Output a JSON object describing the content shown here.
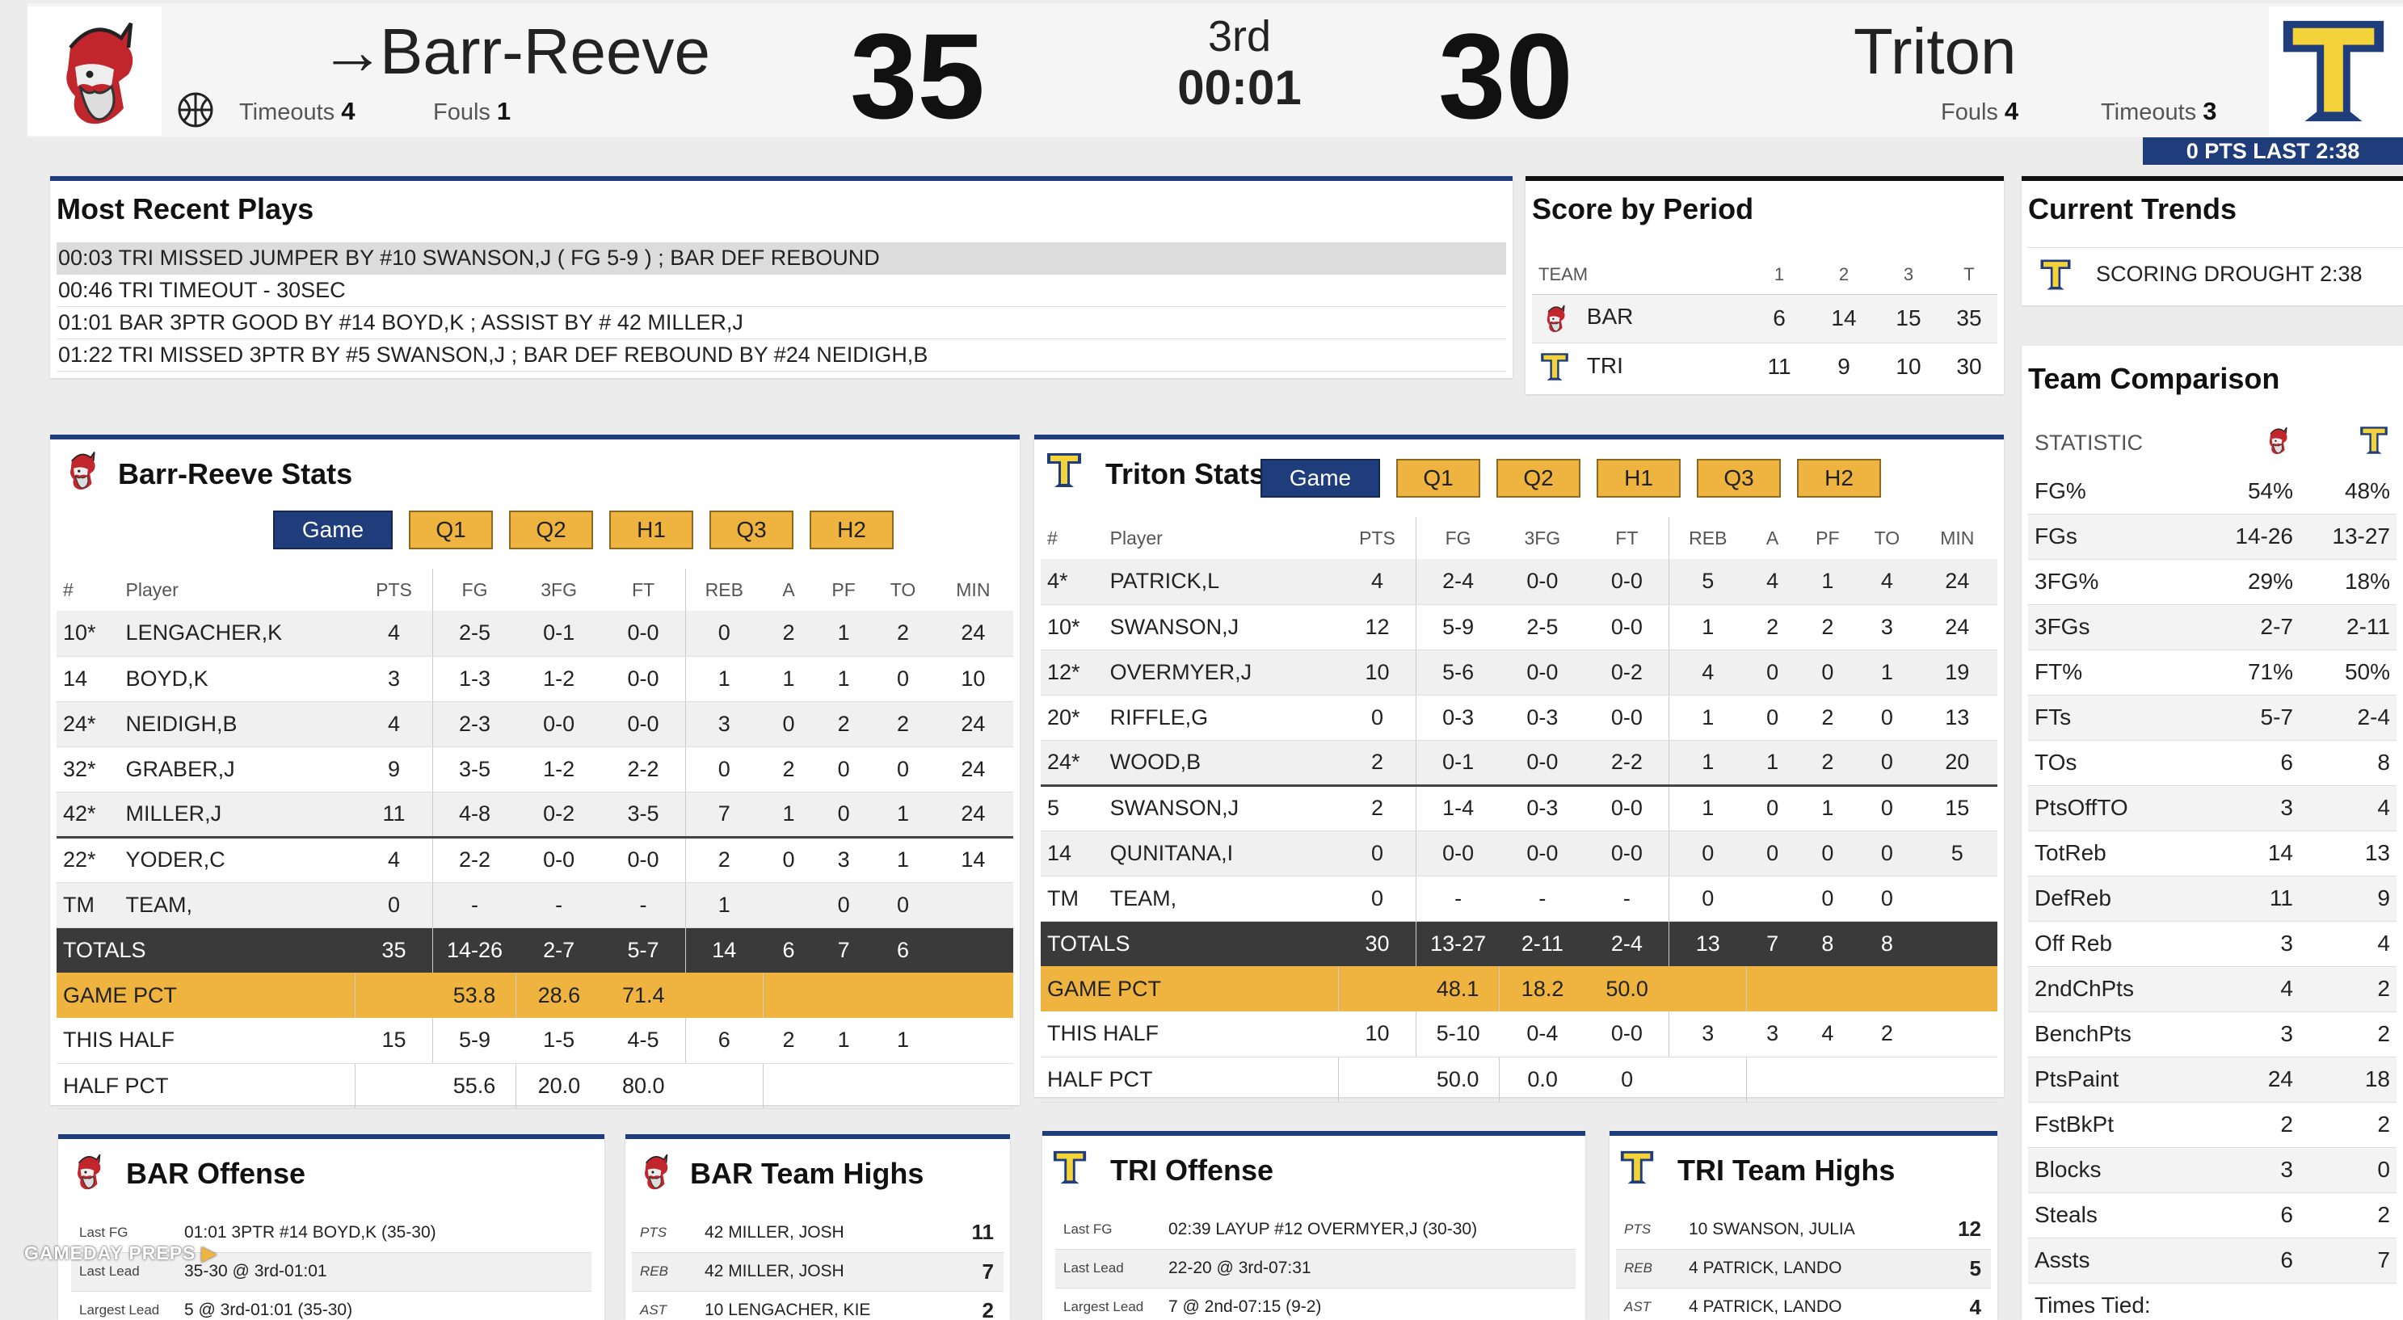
{
  "scoreboard": {
    "home": {
      "name": "Barr-Reeve",
      "score": "35",
      "timeouts_label": "Timeouts",
      "timeouts": "4",
      "fouls_label": "Fouls",
      "fouls": "1",
      "possession_arrow": "→"
    },
    "away": {
      "name": "Triton",
      "score": "30",
      "fouls_label": "Fouls",
      "fouls": "4",
      "timeouts_label": "Timeouts",
      "timeouts": "3"
    },
    "period": "3rd",
    "clock": "00:01",
    "drought_bar": "0 PTS LAST 2:38"
  },
  "recent_plays": {
    "title": "Most Recent Plays",
    "items": [
      "00:03 TRI MISSED JUMPER BY #10 SWANSON,J ( FG 5-9 ) ; BAR DEF REBOUND",
      "00:46 TRI TIMEOUT - 30SEC",
      "01:01 BAR 3PTR GOOD BY #14 BOYD,K ; ASSIST BY # 42 MILLER,J",
      "01:22 TRI MISSED 3PTR BY #5 SWANSON,J ; BAR DEF REBOUND BY #24 NEIDIGH,B"
    ]
  },
  "score_by_period": {
    "title": "Score by Period",
    "headers": [
      "TEAM",
      "1",
      "2",
      "3",
      "T"
    ],
    "rows": [
      {
        "team": "BAR",
        "p1": "6",
        "p2": "14",
        "p3": "15",
        "t": "35"
      },
      {
        "team": "TRI",
        "p1": "11",
        "p2": "9",
        "p3": "10",
        "t": "30"
      }
    ]
  },
  "trends": {
    "title": "Current Trends",
    "item": "SCORING DROUGHT 2:38"
  },
  "buttons": [
    "Game",
    "Q1",
    "Q2",
    "H1",
    "Q3",
    "H2"
  ],
  "stat_headers": [
    "#",
    "Player",
    "PTS",
    "FG",
    "3FG",
    "FT",
    "REB",
    "A",
    "PF",
    "TO",
    "MIN"
  ],
  "home_stats": {
    "title": "Barr-Reeve Stats",
    "players": [
      [
        "10*",
        "LENGACHER,K",
        "4",
        "2-5",
        "0-1",
        "0-0",
        "0",
        "2",
        "1",
        "2",
        "24"
      ],
      [
        "14",
        "BOYD,K",
        "3",
        "1-3",
        "1-2",
        "0-0",
        "1",
        "1",
        "1",
        "0",
        "10"
      ],
      [
        "24*",
        "NEIDIGH,B",
        "4",
        "2-3",
        "0-0",
        "0-0",
        "3",
        "0",
        "2",
        "2",
        "24"
      ],
      [
        "32*",
        "GRABER,J",
        "9",
        "3-5",
        "1-2",
        "2-2",
        "0",
        "2",
        "0",
        "0",
        "24"
      ],
      [
        "42*",
        "MILLER,J",
        "11",
        "4-8",
        "0-2",
        "3-5",
        "7",
        "1",
        "0",
        "1",
        "24"
      ],
      [
        "22*",
        "YODER,C",
        "4",
        "2-2",
        "0-0",
        "0-0",
        "2",
        "0",
        "3",
        "1",
        "14"
      ],
      [
        "TM",
        "TEAM,",
        "0",
        "-",
        "-",
        "-",
        "1",
        "",
        "0",
        "0",
        ""
      ]
    ],
    "totals": [
      "TOTALS",
      "35",
      "14-26",
      "2-7",
      "5-7",
      "14",
      "6",
      "7",
      "6"
    ],
    "game_pct": [
      "GAME PCT",
      "53.8",
      "28.6",
      "71.4"
    ],
    "this_half": [
      "THIS HALF",
      "15",
      "5-9",
      "1-5",
      "4-5",
      "6",
      "2",
      "1",
      "1"
    ],
    "half_pct": [
      "HALF PCT",
      "55.6",
      "20.0",
      "80.0"
    ]
  },
  "away_stats": {
    "title": "Triton Stats",
    "players": [
      [
        "4*",
        "PATRICK,L",
        "4",
        "2-4",
        "0-0",
        "0-0",
        "5",
        "4",
        "1",
        "4",
        "24"
      ],
      [
        "10*",
        "SWANSON,J",
        "12",
        "5-9",
        "2-5",
        "0-0",
        "1",
        "2",
        "2",
        "3",
        "24"
      ],
      [
        "12*",
        "OVERMYER,J",
        "10",
        "5-6",
        "0-0",
        "0-2",
        "4",
        "0",
        "0",
        "1",
        "19"
      ],
      [
        "20*",
        "RIFFLE,G",
        "0",
        "0-3",
        "0-3",
        "0-0",
        "1",
        "0",
        "2",
        "0",
        "13"
      ],
      [
        "24*",
        "WOOD,B",
        "2",
        "0-1",
        "0-0",
        "2-2",
        "1",
        "1",
        "2",
        "0",
        "20"
      ],
      [
        "5",
        "SWANSON,J",
        "2",
        "1-4",
        "0-3",
        "0-0",
        "1",
        "0",
        "1",
        "0",
        "15"
      ],
      [
        "14",
        "QUNITANA,I",
        "0",
        "0-0",
        "0-0",
        "0-0",
        "0",
        "0",
        "0",
        "0",
        "5"
      ],
      [
        "TM",
        "TEAM,",
        "0",
        "-",
        "-",
        "-",
        "0",
        "",
        "0",
        "0",
        ""
      ]
    ],
    "totals": [
      "TOTALS",
      "30",
      "13-27",
      "2-11",
      "2-4",
      "13",
      "7",
      "8",
      "8"
    ],
    "game_pct": [
      "GAME PCT",
      "48.1",
      "18.2",
      "50.0"
    ],
    "this_half": [
      "THIS HALF",
      "10",
      "5-10",
      "0-4",
      "0-0",
      "3",
      "3",
      "4",
      "2"
    ],
    "half_pct": [
      "HALF PCT",
      "50.0",
      "0.0",
      "0"
    ]
  },
  "comparison": {
    "title": "Team Comparison",
    "header": "STATISTIC",
    "rows": [
      [
        "FG%",
        "54%",
        "48%"
      ],
      [
        "FGs",
        "14-26",
        "13-27"
      ],
      [
        "3FG%",
        "29%",
        "18%"
      ],
      [
        "3FGs",
        "2-7",
        "2-11"
      ],
      [
        "FT%",
        "71%",
        "50%"
      ],
      [
        "FTs",
        "5-7",
        "2-4"
      ],
      [
        "TOs",
        "6",
        "8"
      ],
      [
        "PtsOffTO",
        "3",
        "4"
      ],
      [
        "TotReb",
        "14",
        "13"
      ],
      [
        "DefReb",
        "11",
        "9"
      ],
      [
        "Off Reb",
        "3",
        "4"
      ],
      [
        "2ndChPts",
        "4",
        "2"
      ],
      [
        "BenchPts",
        "3",
        "2"
      ],
      [
        "PtsPaint",
        "24",
        "18"
      ],
      [
        "FstBkPt",
        "2",
        "2"
      ],
      [
        "Blocks",
        "3",
        "0"
      ],
      [
        "Steals",
        "6",
        "2"
      ],
      [
        "Assts",
        "6",
        "7"
      ]
    ],
    "partial_row": "Times Tied:"
  },
  "bar_offense": {
    "title": "BAR Offense",
    "rows": [
      {
        "k": "Last FG",
        "v": "01:01 3PTR #14 BOYD,K (35-30)"
      },
      {
        "k": "Last Lead",
        "v": "35-30 @ 3rd-01:01"
      },
      {
        "k": "Largest Lead",
        "v": "5 @ 3rd-01:01 (35-30)"
      }
    ]
  },
  "bar_highs": {
    "title": "BAR Team Highs",
    "rows": [
      {
        "k": "PTS",
        "v": "42 MILLER, JOSH",
        "n": "11"
      },
      {
        "k": "REB",
        "v": "42 MILLER, JOSH",
        "n": "7"
      },
      {
        "k": "AST",
        "v": "10 LENGACHER, KIE",
        "n": "2"
      }
    ]
  },
  "tri_offense": {
    "title": "TRI Offense",
    "rows": [
      {
        "k": "Last FG",
        "v": "02:39 LAYUP #12 OVERMYER,J (30-30)"
      },
      {
        "k": "Last Lead",
        "v": "22-20 @ 3rd-07:31"
      },
      {
        "k": "Largest Lead",
        "v": "7 @ 2nd-07:15 (9-2)"
      }
    ]
  },
  "tri_highs": {
    "title": "TRI Team Highs",
    "rows": [
      {
        "k": "PTS",
        "v": "10 SWANSON, JULIA",
        "n": "12"
      },
      {
        "k": "REB",
        "v": "4 PATRICK, LANDO",
        "n": "5"
      },
      {
        "k": "AST",
        "v": "4 PATRICK, LANDO",
        "n": "4"
      }
    ]
  },
  "watermark": "GAMEDAY PREPS",
  "colors": {
    "navy": "#1e3d7a",
    "gold": "#efb43f",
    "totals": "#3a3a3a",
    "triton_yellow": "#f3d23a",
    "barr_red": "#c0262c"
  }
}
